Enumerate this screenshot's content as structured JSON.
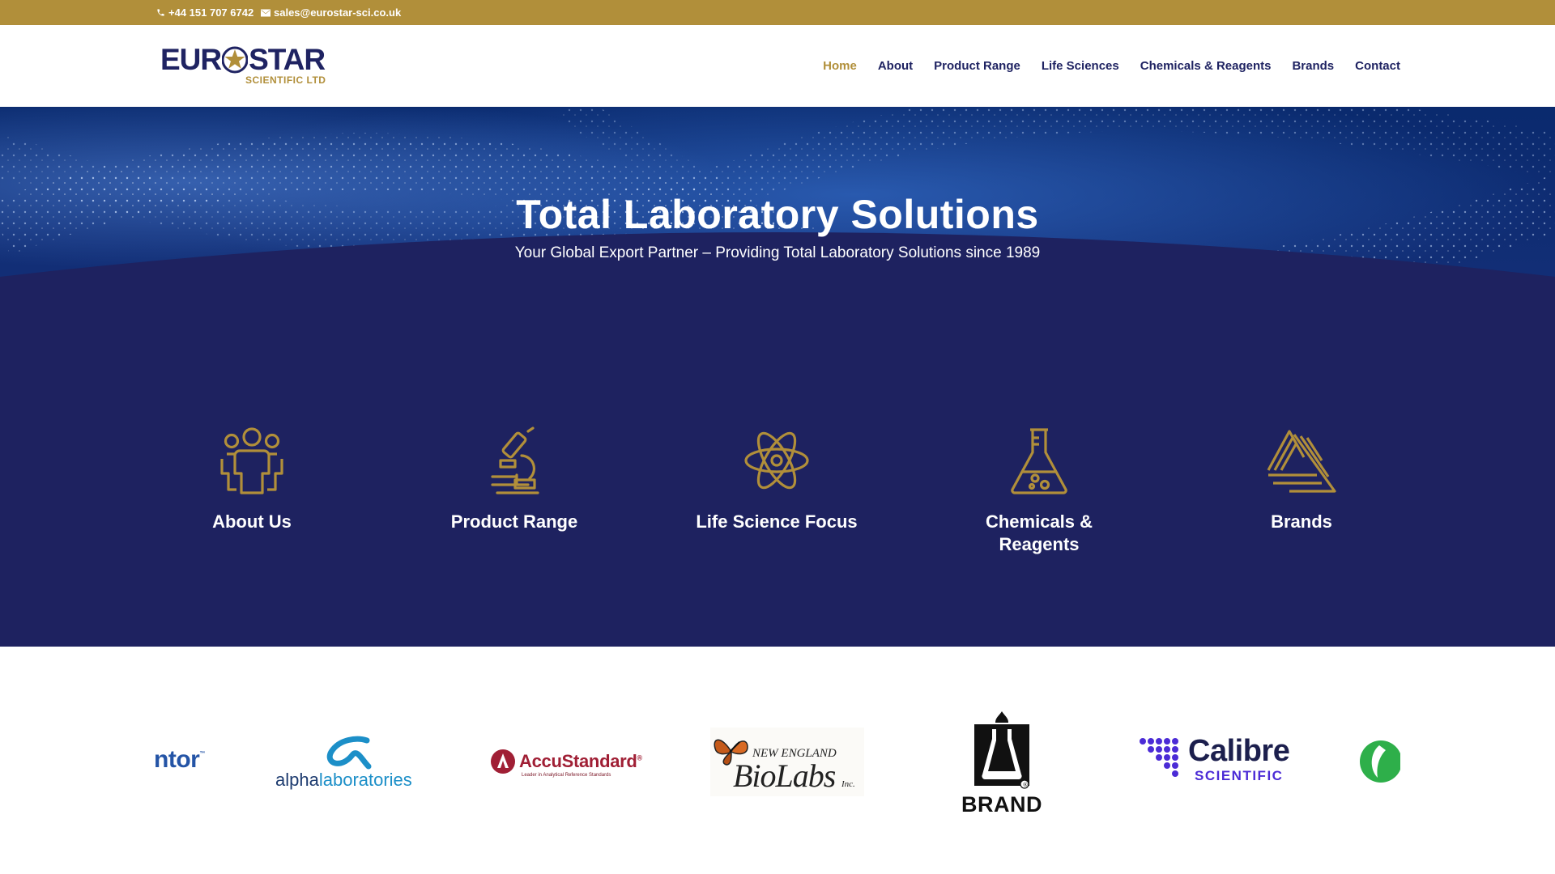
{
  "topbar": {
    "phone": "+44 151 707 6742",
    "email": "sales@eurostar-sci.co.uk",
    "icons": [
      "phone-icon",
      "envelope-icon"
    ]
  },
  "header": {
    "logo": {
      "word_left": "EUR",
      "word_right": "STAR",
      "subtitle": "SCIENTIFIC LTD"
    },
    "nav": [
      {
        "label": "Home",
        "active": true
      },
      {
        "label": "About",
        "active": false
      },
      {
        "label": "Product Range",
        "active": false
      },
      {
        "label": "Life Sciences",
        "active": false
      },
      {
        "label": "Chemicals & Reagents",
        "active": false
      },
      {
        "label": "Brands",
        "active": false
      },
      {
        "label": "Contact",
        "active": false
      }
    ]
  },
  "hero": {
    "title": "Total Laboratory Solutions",
    "subtitle": "Your Global Export Partner – Providing Total Laboratory Solutions since 1989"
  },
  "features": [
    {
      "label": "About Us",
      "icon": "people-icon"
    },
    {
      "label": "Product Range",
      "icon": "microscope-icon"
    },
    {
      "label": "Life Science Focus",
      "icon": "atom-icon"
    },
    {
      "label": "Chemicals &\nReagents",
      "icon": "flask-icon"
    },
    {
      "label": "Brands",
      "icon": "brands-triangle-icon"
    }
  ],
  "brands": {
    "mentor_partial": "ntor",
    "mentor_mark": "™",
    "alpha": {
      "part1": "alpha",
      "part2": "laboratories"
    },
    "accustandard": {
      "name": "AccuStandard",
      "mark": "®",
      "tagline": "Leader in Analytical Reference Standards"
    },
    "neb": {
      "top": "NEW ENGLAND",
      "main": "BioLabs",
      "suffix": "Inc."
    },
    "brand": {
      "name": "BRAND",
      "mark": "®"
    },
    "calibre": {
      "name": "Calibre",
      "sub": "SCIENTIFIC"
    }
  },
  "colors": {
    "gold": "#b18f3a",
    "navy": "#1e2260",
    "white": "#ffffff"
  }
}
